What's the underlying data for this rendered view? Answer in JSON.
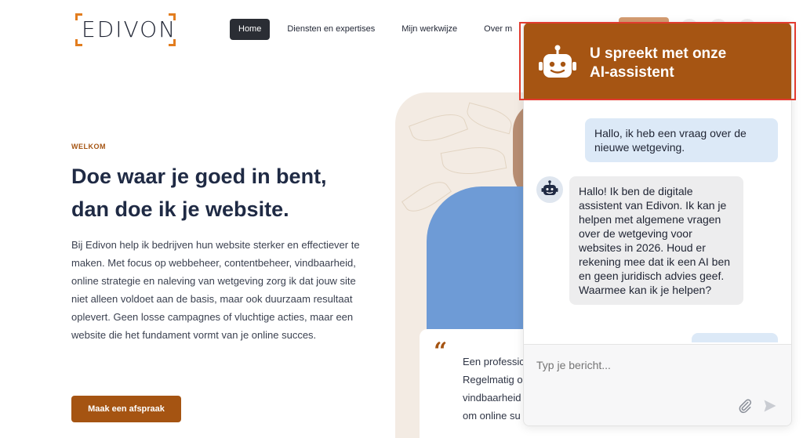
{
  "header": {
    "logo_text": "EDIVON",
    "nav": [
      {
        "label": "Home",
        "active": true
      },
      {
        "label": "Diensten en expertises",
        "active": false
      },
      {
        "label": "Mijn werkwijze",
        "active": false
      },
      {
        "label": "Over m",
        "active": false
      }
    ]
  },
  "hero": {
    "kicker": "WELKOM",
    "title_line1": "Doe waar je goed in bent,",
    "title_line2": "dan doe ik je website.",
    "body": "Bij Edivon help ik bedrijven hun website sterker en effectiever te maken. Met focus op webbeheer, contentbeheer, vindbaarheid, online strategie en naleving van wetgeving zorg ik dat jouw site niet alleen voldoet aan de basis, maar ook duurzaam resultaat oplevert. Geen losse campagnes of vluchtige acties, maar een website die het fundament vormt van je online succes.",
    "cta_label": "Maak een afspraak"
  },
  "quote": {
    "mark": "“",
    "lines": [
      "Een professic",
      "Regelmatig o",
      "vindbaarheid",
      "om online su"
    ]
  },
  "chat": {
    "title_line1": "U spreekt met onze",
    "title_line2": "AI-assistent",
    "user_message": "Hallo, ik heb een vraag over de nieuwe wetgeving.",
    "bot_message": "Hallo! Ik ben de digitale assistent van Edivon. Ik kan je helpen met algemene vragen over de wetgeving voor websites in 2026. Houd er rekening mee dat ik een AI ben en geen juridisch advies geef. Waarmee kan ik je helpen?",
    "input_placeholder": "Typ je bericht...",
    "accent_color": "#a65513",
    "highlight_color": "#e23b2f"
  },
  "icons": {
    "logo": "edivon-bracket-logo",
    "bot": "robot-icon",
    "attach": "paperclip-icon",
    "send": "send-arrow-icon"
  }
}
